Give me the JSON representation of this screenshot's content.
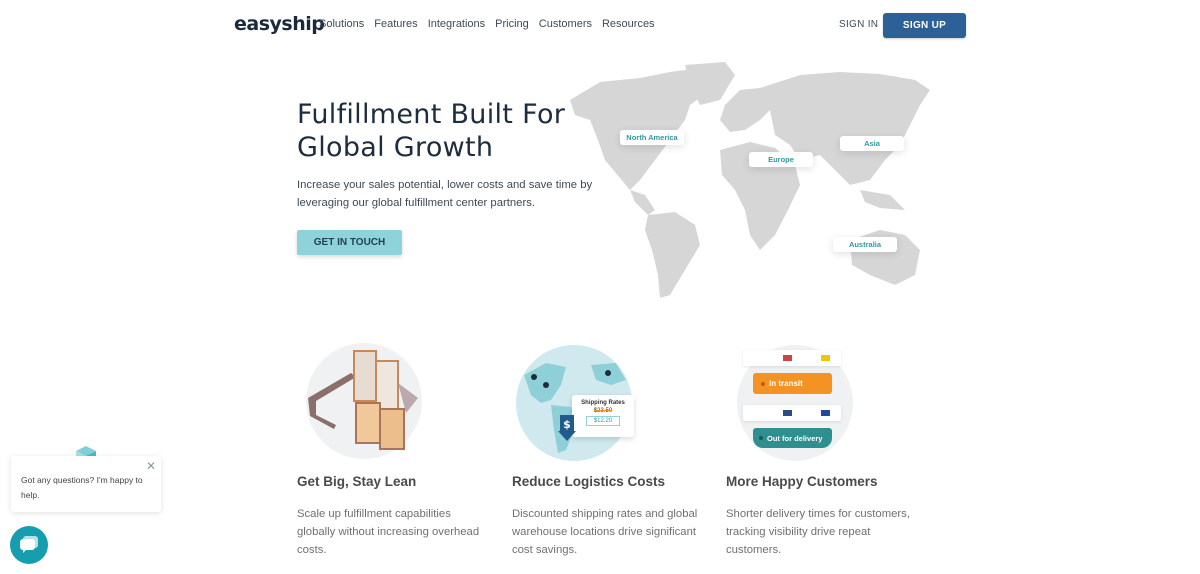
{
  "nav": {
    "logo": "easyship",
    "menu": [
      "Solutions",
      "Features",
      "Integrations",
      "Pricing",
      "Customers",
      "Resources"
    ],
    "sign_in": "SIGN IN",
    "sign_up": "SIGN UP"
  },
  "hero": {
    "title_line1": "Fulfillment Built For",
    "title_line2": "Global Growth",
    "subtitle": "Increase your sales potential, lower costs and save time by leveraging our global fulfillment center partners.",
    "cta": "GET IN TOUCH",
    "map_labels": [
      "North America",
      "Europe",
      "Asia",
      "Australia"
    ]
  },
  "features": [
    {
      "title": "Get Big, Stay Lean",
      "desc": "Scale up fulfillment capabilities globally without increasing overhead costs.",
      "icon": "warehouse-illustration"
    },
    {
      "title": "Reduce Logistics Costs",
      "desc": "Discounted shipping rates and global warehouse locations drive significant cost savings.",
      "icon": "globe-shipping-rates-illustration",
      "card": {
        "title": "Shipping Rates",
        "old_price": "$23.50",
        "new_price": "$12.20"
      }
    },
    {
      "title": "More Happy Customers",
      "desc": "Shorter delivery times for customers, tracking visibility drive repeat customers.",
      "icon": "tracking-status-illustration",
      "statuses": [
        "In transit",
        "Out for delivery"
      ]
    }
  ],
  "chat": {
    "message": "Got any questions? I'm happy to help."
  },
  "colors": {
    "brand": "#2b6196",
    "cta": "#8dd3d9",
    "teal": "#2f9aa0",
    "orange": "#f39324",
    "chat": "#159eb0"
  }
}
